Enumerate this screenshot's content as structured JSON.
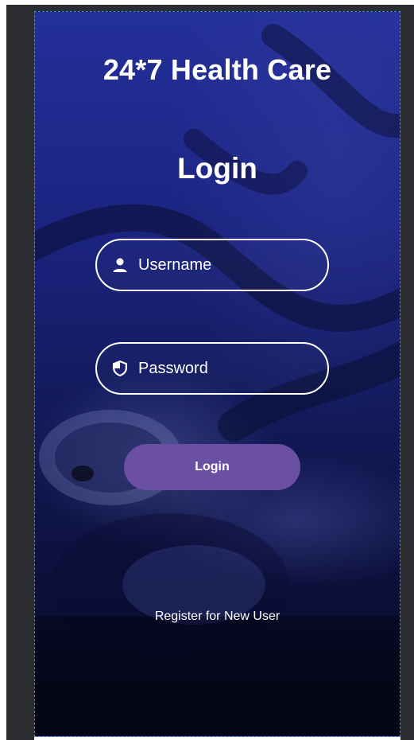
{
  "app": {
    "title": "24*7 Health Care",
    "screen_title": "Login"
  },
  "form": {
    "username": {
      "placeholder": "Username",
      "value": "",
      "icon": "person-icon"
    },
    "password": {
      "placeholder": "Password",
      "value": "",
      "icon": "shield-icon"
    },
    "login_button_label": "Login",
    "register_link_label": "Register for New User"
  },
  "colors": {
    "background_top": "#24309a",
    "background_bottom": "#05081c",
    "button": "#6a4fa3",
    "text": "#ffffff",
    "border": "#ffffff"
  }
}
